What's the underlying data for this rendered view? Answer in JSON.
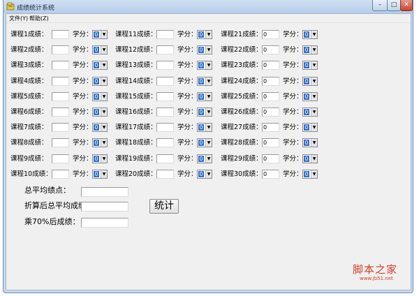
{
  "window": {
    "title": "成绩统计系统",
    "controls": {
      "minimize": "–",
      "maximize": "□",
      "close": "✕"
    }
  },
  "menu": [
    "文件(Y)",
    "帮助(Z)"
  ],
  "courses": [
    {
      "label": "课程1成绩：",
      "grade": "",
      "credit_label": "学分：",
      "credit": "0"
    },
    {
      "label": "课程2成绩：",
      "grade": "",
      "credit_label": "学分：",
      "credit": "0"
    },
    {
      "label": "课程3成绩：",
      "grade": "",
      "credit_label": "学分：",
      "credit": "0"
    },
    {
      "label": "课程4成绩：",
      "grade": "",
      "credit_label": "学分：",
      "credit": "0"
    },
    {
      "label": "课程5成绩：",
      "grade": "",
      "credit_label": "学分：",
      "credit": "0"
    },
    {
      "label": "课程6成绩：",
      "grade": "",
      "credit_label": "学分：",
      "credit": "0"
    },
    {
      "label": "课程7成绩：",
      "grade": "",
      "credit_label": "学分：",
      "credit": "0"
    },
    {
      "label": "课程8成绩：",
      "grade": "",
      "credit_label": "学分：",
      "credit": "0"
    },
    {
      "label": "课程9成绩：",
      "grade": "",
      "credit_label": "学分：",
      "credit": "0"
    },
    {
      "label": "课程10成绩：",
      "grade": "",
      "credit_label": "学分：",
      "credit": "0"
    },
    {
      "label": "课程11成绩：",
      "grade": "",
      "credit_label": "学分：",
      "credit": "0"
    },
    {
      "label": "课程12成绩：",
      "grade": "",
      "credit_label": "学分：",
      "credit": "0"
    },
    {
      "label": "课程13成绩：",
      "grade": "",
      "credit_label": "学分：",
      "credit": "0"
    },
    {
      "label": "课程14成绩：",
      "grade": "",
      "credit_label": "学分：",
      "credit": "0"
    },
    {
      "label": "课程15成绩：",
      "grade": "",
      "credit_label": "学分：",
      "credit": "0"
    },
    {
      "label": "课程16成绩：",
      "grade": "",
      "credit_label": "学分：",
      "credit": "0"
    },
    {
      "label": "课程17成绩：",
      "grade": "",
      "credit_label": "学分：",
      "credit": "0"
    },
    {
      "label": "课程18成绩：",
      "grade": "",
      "credit_label": "学分：",
      "credit": "0"
    },
    {
      "label": "课程19成绩：",
      "grade": "",
      "credit_label": "学分：",
      "credit": "0"
    },
    {
      "label": "课程20成绩：",
      "grade": "",
      "credit_label": "学分：",
      "credit": "0"
    },
    {
      "label": "课程21成绩：",
      "grade": "0",
      "credit_label": "学分：",
      "credit": "0"
    },
    {
      "label": "课程22成绩：",
      "grade": "0",
      "credit_label": "学分：",
      "credit": "0"
    },
    {
      "label": "课程23成绩：",
      "grade": "0",
      "credit_label": "学分：",
      "credit": "0"
    },
    {
      "label": "课程24成绩：",
      "grade": "0",
      "credit_label": "学分：",
      "credit": "0"
    },
    {
      "label": "课程25成绩：",
      "grade": "0",
      "credit_label": "学分：",
      "credit": "0"
    },
    {
      "label": "课程26成绩：",
      "grade": "0",
      "credit_label": "学分：",
      "credit": "0"
    },
    {
      "label": "课程27成绩：",
      "grade": "0",
      "credit_label": "学分：",
      "credit": "0"
    },
    {
      "label": "课程28成绩：",
      "grade": "0",
      "credit_label": "学分：",
      "credit": "0"
    },
    {
      "label": "课程29成绩：",
      "grade": "0",
      "credit_label": "学分：",
      "credit": "0"
    },
    {
      "label": "课程30成绩：",
      "grade": "0",
      "credit_label": "学分：",
      "credit": "0"
    }
  ],
  "summary": {
    "gpa_label": "总平均绩点：",
    "converted_label": "折算后总平均成绩：",
    "times70_label": "乘70%后成绩：",
    "gpa_value": "",
    "converted_value": "",
    "times70_value": ""
  },
  "calc_button": "统计",
  "watermark": {
    "text": "脚本之家",
    "url": "www.jb51.net"
  },
  "colors": {
    "select_highlight": "#3271c8",
    "watermark": "#d13c28"
  },
  "icons": {
    "app": "folder-icon",
    "dropdown": "chevron-down-icon"
  }
}
